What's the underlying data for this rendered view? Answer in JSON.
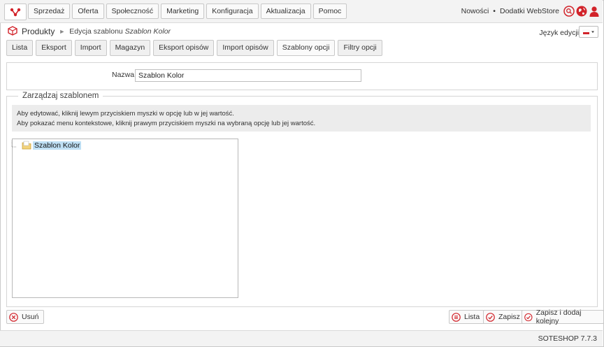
{
  "colors": {
    "accent": "#d2232a",
    "tree_highlight": "#bfe0f5"
  },
  "nav": {
    "logo_icon": "soteshop-logo-icon",
    "menu": [
      "Sprzedaż",
      "Oferta",
      "Społeczność",
      "Marketing",
      "Konfiguracja",
      "Aktualizacja",
      "Pomoc"
    ],
    "links": {
      "news": "Nowości",
      "separator": "•",
      "addons": "Dodatki WebStore"
    },
    "icons": [
      "search-icon",
      "globe-icon",
      "user-icon"
    ]
  },
  "breadcrumb": {
    "root": "Produkty",
    "separator": "►",
    "current_prefix": "Edycja szablonu",
    "current_name": "Szablon Kolor"
  },
  "language": {
    "label": "Język edycji",
    "selected_flag": "pl-flag-icon"
  },
  "tabs": [
    "Lista",
    "Eksport",
    "Import",
    "Magazyn",
    "Eksport opisów",
    "Import opisów",
    "Szablony opcji",
    "Filtry opcji"
  ],
  "active_tab": "Szablony opcji",
  "form": {
    "name_label": "Nazwa",
    "name_value": "Szablon Kolor"
  },
  "manage": {
    "legend": "Zarządzaj szablonem",
    "info_line1": "Aby edytować, kliknij lewym przyciskiem myszki w opcję lub w jej wartość.",
    "info_line2": "Aby pokazać menu kontekstowe, kliknij prawym przyciskiem myszki na wybraną opcję lub jej wartość.",
    "tree_root": "Szablon Kolor"
  },
  "actions": {
    "delete": "Usuń",
    "list": "Lista",
    "save": "Zapisz",
    "save_add": "Zapisz i dodaj kolejny"
  },
  "footer": {
    "version": "SOTESHOP 7.7.3"
  }
}
